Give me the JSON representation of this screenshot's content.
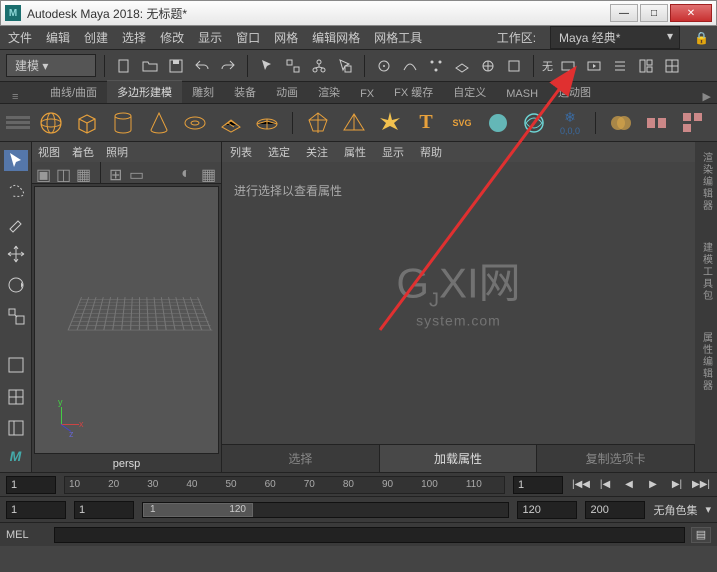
{
  "window": {
    "title": "Autodesk Maya 2018: 无标题*",
    "app_initial": "M"
  },
  "menu": {
    "items": [
      "文件",
      "编辑",
      "创建",
      "选择",
      "修改",
      "显示",
      "窗口",
      "网格",
      "编辑网格",
      "网格工具"
    ],
    "workspace_label": "工作区:",
    "workspace_value": "Maya 经典*"
  },
  "toolbar": {
    "mode": "建模",
    "right_label": "无"
  },
  "shelf": {
    "tabs": [
      "曲线/曲面",
      "多边形建模",
      "雕刻",
      "装备",
      "动画",
      "渲染",
      "FX",
      "FX 缓存",
      "自定义",
      "MASH",
      "运动图"
    ],
    "active_index": 1,
    "svg_label": "SVG",
    "snow_label": "0,0,0"
  },
  "viewport": {
    "menu": [
      "视图",
      "着色",
      "照明"
    ],
    "camera": "persp"
  },
  "attr": {
    "menu": [
      "列表",
      "选定",
      "关注",
      "属性",
      "显示",
      "帮助"
    ],
    "empty_msg": "进行选择以查看属性",
    "tabs": [
      "选择",
      "加载属性",
      "复制选项卡"
    ],
    "active_tab": 1
  },
  "right_panels": [
    "渲染编辑器",
    "建模工具包",
    "属性编辑器"
  ],
  "timeline": {
    "start_vis": "1",
    "ticks": [
      "10",
      "20",
      "30",
      "40",
      "50",
      "60",
      "70",
      "80",
      "90",
      "100",
      "110",
      "1"
    ],
    "current": "1"
  },
  "range": {
    "start": "1",
    "play_start": "1",
    "thumb_start": "1",
    "thumb_end": "120",
    "play_end": "120",
    "end": "200",
    "charset": "无角色集"
  },
  "cmd": {
    "label": "MEL"
  },
  "watermark": {
    "big_g": "G",
    "big_xi": "XI",
    "big_net": "网",
    "sub": "system.com",
    "sub_j": "J"
  }
}
